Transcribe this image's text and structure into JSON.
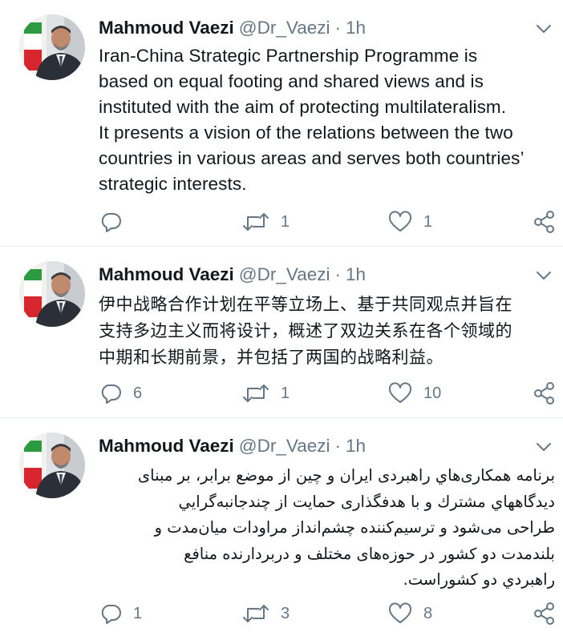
{
  "colors": {
    "text": "#14171a",
    "secondary": "#657786",
    "divider": "#e6ecf0",
    "icon": "#657786"
  },
  "icons": {
    "caret": "chevron-down-icon",
    "reply": "reply-icon",
    "retweet": "retweet-icon",
    "like": "heart-icon",
    "share": "share-icon"
  },
  "tweets": [
    {
      "author": {
        "name": "Mahmoud Vaezi",
        "handle": "@Dr_Vaezi"
      },
      "separator": "·",
      "time": "1h",
      "text": "Iran-China  Strategic Partnership Programme is\nbased on equal footing and shared views and is\ninstituted with the aim of protecting multilateralism.\nIt presents a vision of the relations between the two\ncountries in various areas and serves both countries’\nstrategic interests.",
      "replies": "",
      "retweets": "1",
      "likes": "1"
    },
    {
      "author": {
        "name": "Mahmoud Vaezi",
        "handle": "@Dr_Vaezi"
      },
      "separator": "·",
      "time": "1h",
      "text": "伊中战略合作计划在平等立场上、基于共同观点并旨在\n支持多边主义而将设计，概述了双边关系在各个领域的\n中期和长期前景，并包括了两国的战略利益。",
      "replies": "6",
      "retweets": "1",
      "likes": "10"
    },
    {
      "author": {
        "name": "Mahmoud Vaezi",
        "handle": "@Dr_Vaezi"
      },
      "separator": "·",
      "time": "1h",
      "text": "برنامه همکاری‌هاي راهبردی ايران و چين از موضع برابر، بر مبنای\nديدگاههاي مشترك و با هدفگذاری حمايت از چندجانبه‌گرايي\nطراحی می‌شود و ترسيم‌كننده چشم‌انداز مراودات ميان‌مدت و\nبلندمدت دو کشور در حوزه‌های مختلف و دربردارنده منافع\nراهبردي دو كشوراست.",
      "replies": "1",
      "retweets": "3",
      "likes": "8"
    }
  ]
}
